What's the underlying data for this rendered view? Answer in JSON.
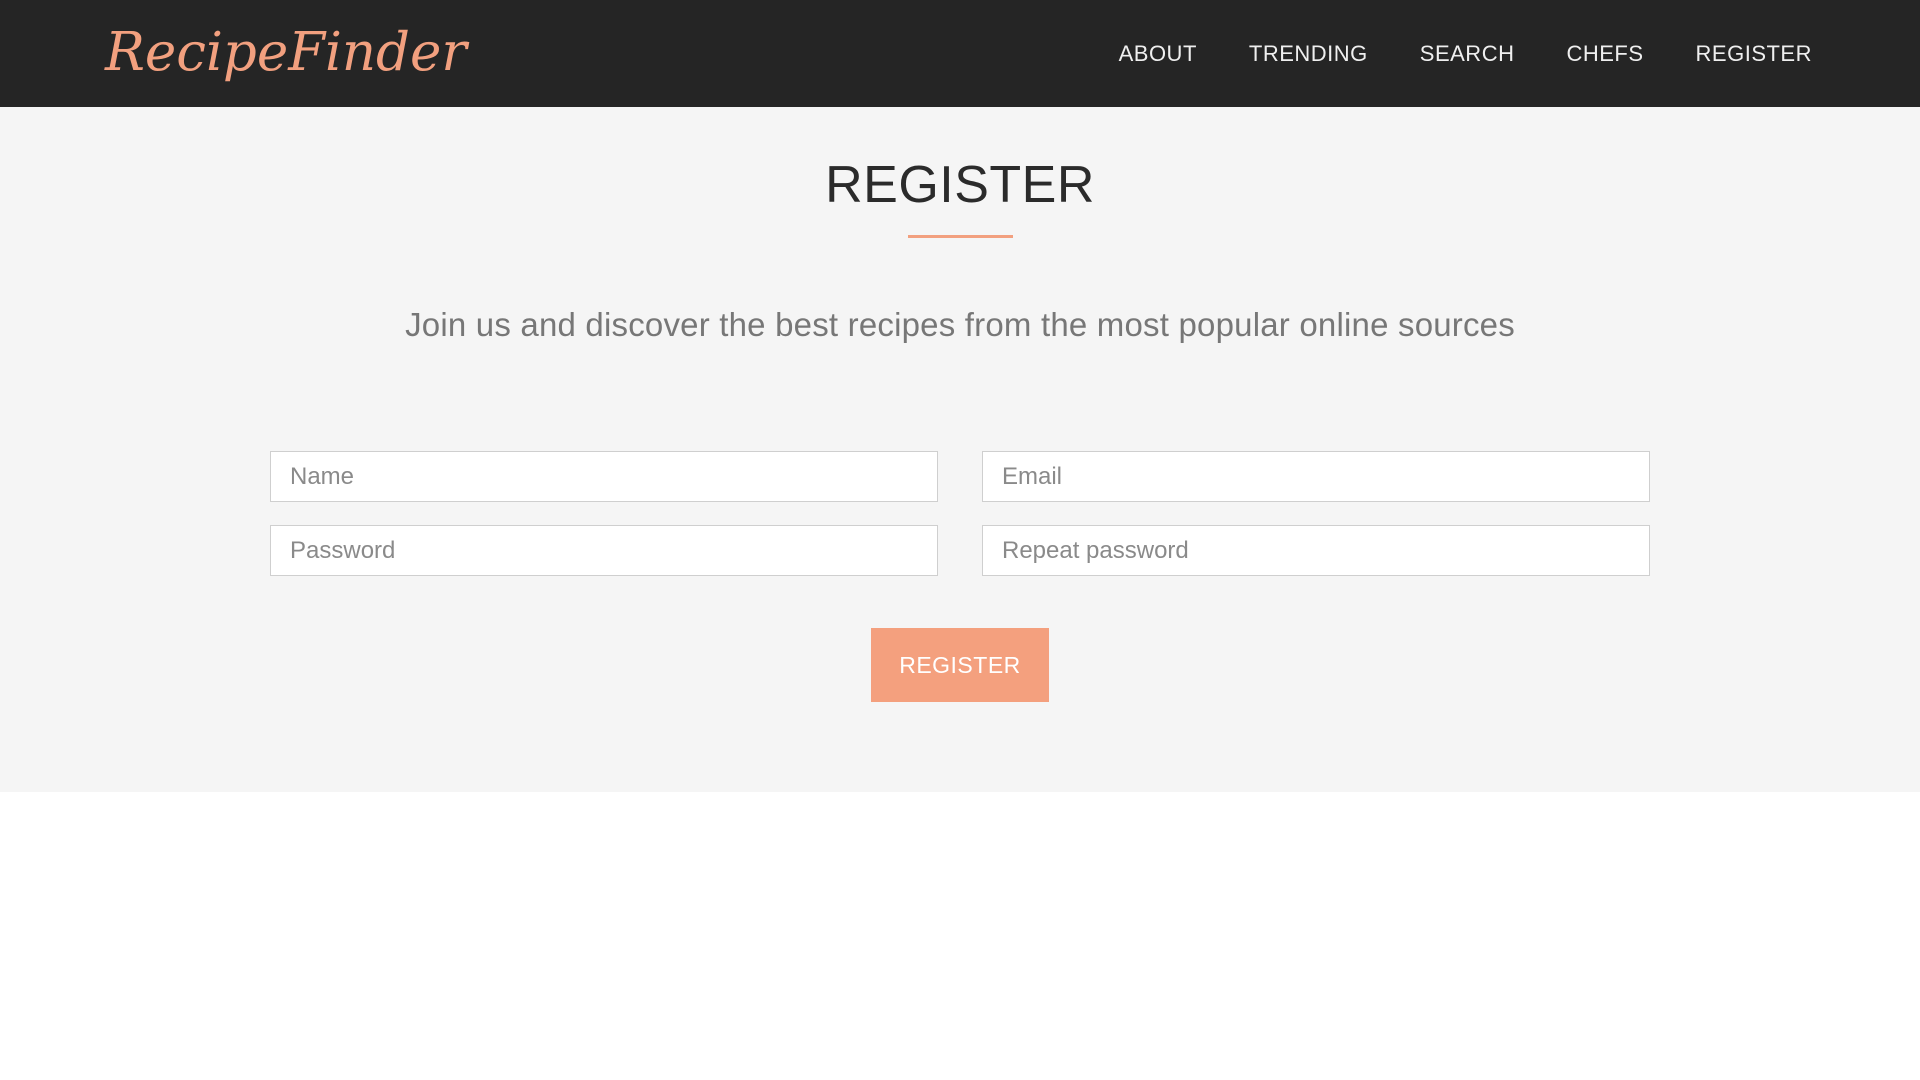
{
  "header": {
    "brand": "RecipeFinder",
    "nav": [
      {
        "label": "ABOUT"
      },
      {
        "label": "TRENDING"
      },
      {
        "label": "SEARCH"
      },
      {
        "label": "CHEFS"
      },
      {
        "label": "REGISTER"
      }
    ]
  },
  "register": {
    "title": "REGISTER",
    "subtitle": "Join us and discover the best recipes from the most popular online sources",
    "fields": {
      "name": {
        "placeholder": "Name",
        "value": ""
      },
      "email": {
        "placeholder": "Email",
        "value": ""
      },
      "password": {
        "placeholder": "Password",
        "value": ""
      },
      "repeat_password": {
        "placeholder": "Repeat password",
        "value": ""
      }
    },
    "submit_label": "REGISTER"
  },
  "colors": {
    "accent": "#f2a07f",
    "navbar_bg": "#252525",
    "section_bg": "#f5f5f5"
  }
}
